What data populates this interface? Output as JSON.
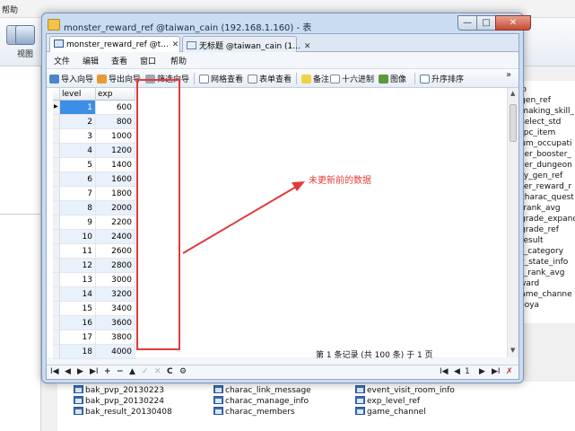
{
  "bg_menu": [
    "帮助"
  ],
  "bg_toolbar": {
    "view_label": "视图"
  },
  "bg_right_list": [
    "info",
    "n_gen_ref",
    "n_making_skill_",
    "n_select_std",
    "t_npc_item",
    "_num_occupati",
    "mber_booster_",
    "mber_dungeon",
    "iney_gen_ref",
    "nster_reward_r",
    "y_charac_quest",
    "ty_rank_avg",
    "o_grade_expanc",
    "o_grade_ref",
    "o_result",
    "est_category",
    "ver_state_info",
    "gle_rank_avg",
    "reward",
    "_game_channe",
    "_sooya"
  ],
  "bg_bottom_list": [
    [
      "bak_pvp_20130223",
      "charac_link_message",
      "event_visit_room_info"
    ],
    [
      "bak_pvp_20130224",
      "charac_manage_info",
      "exp_level_ref"
    ],
    [
      "bak_result_20130408",
      "charac_members",
      "game_channel"
    ]
  ],
  "window": {
    "title": "monster_reward_ref @taiwan_cain (192.168.1.160) - 表",
    "btn_min": "—",
    "btn_max": "□",
    "btn_close": "✕"
  },
  "tabs": [
    {
      "label": "monster_reward_ref @t...",
      "close": "✕"
    },
    {
      "label": "无标题 @taiwan_cain (1...",
      "close": "✕"
    }
  ],
  "menu": [
    "文件",
    "编辑",
    "查看",
    "窗口",
    "帮助"
  ],
  "toolbar": {
    "import": "导入向导",
    "export": "导出向导",
    "filter": "筛选向导",
    "grid_view": "网格查看",
    "form_view": "表单查看",
    "memo": "备注",
    "hex": "十六进制",
    "image": "图像",
    "sort": "升序排序",
    "more": "»"
  },
  "grid": {
    "columns": [
      "level",
      "exp"
    ],
    "rows": [
      [
        1,
        600
      ],
      [
        2,
        800
      ],
      [
        3,
        1000
      ],
      [
        4,
        1200
      ],
      [
        5,
        1400
      ],
      [
        6,
        1600
      ],
      [
        7,
        1800
      ],
      [
        8,
        2000
      ],
      [
        9,
        2200
      ],
      [
        10,
        2400
      ],
      [
        11,
        2600
      ],
      [
        12,
        2800
      ],
      [
        13,
        3000
      ],
      [
        14,
        3200
      ],
      [
        15,
        3400
      ],
      [
        16,
        3600
      ],
      [
        17,
        3800
      ],
      [
        18,
        4000
      ]
    ],
    "current_row": 1
  },
  "annotation": {
    "text": "未更新前的数据",
    "color": "#e23a3a"
  },
  "nav": {
    "first": "I◀",
    "prev": "◀",
    "next": "▶",
    "last": "▶I",
    "add": "+",
    "delete": "−",
    "up": "▲",
    "check": "✓",
    "cancel": "✕",
    "refresh": "C",
    "stop": "⚙",
    "page_first": "I◀",
    "page_prev": "◀",
    "page_num": "1",
    "page_next": "▶",
    "page_last": "▶I",
    "settings": "✗"
  },
  "status": {
    "text": "第 1 条记录 (共 100 条) 于 1 页"
  }
}
